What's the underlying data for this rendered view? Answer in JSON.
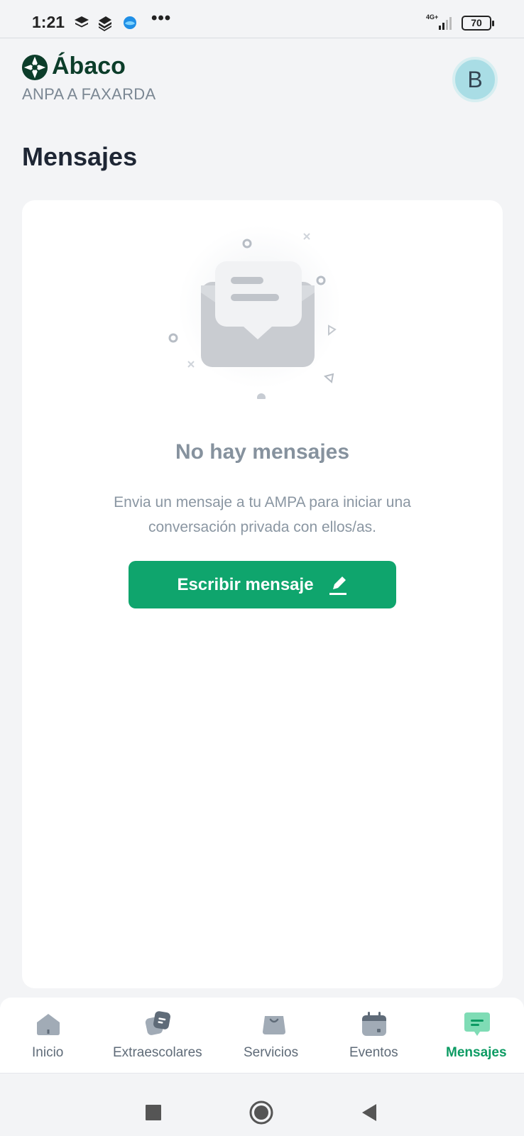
{
  "status_bar": {
    "time": "1:21",
    "overflow": "•••",
    "network": "4G+",
    "battery": "70",
    "notification_icons": [
      "layers-icon",
      "stack-icon",
      "browser-icon"
    ]
  },
  "header": {
    "brand_name": "Ábaco",
    "organization": "ANPA A FAXARDA",
    "avatar_initial": "B"
  },
  "page": {
    "title": "Mensajes"
  },
  "empty_state": {
    "title": "No hay mensajes",
    "description": "Envia un mensaje a tu AMPA para iniciar una conversación privada con ellos/as.",
    "button_label": "Escribir mensaje",
    "button_icon": "pencil-icon"
  },
  "bottom_nav": {
    "items": [
      {
        "label": "Inicio",
        "icon": "home-icon",
        "active": false
      },
      {
        "label": "Extraescolares",
        "icon": "extracurricular-icon",
        "active": false
      },
      {
        "label": "Servicios",
        "icon": "shopping-bag-icon",
        "active": false
      },
      {
        "label": "Eventos",
        "icon": "calendar-icon",
        "active": false
      },
      {
        "label": "Mensajes",
        "icon": "chat-icon",
        "active": true
      }
    ]
  },
  "colors": {
    "accent": "#0fa56d",
    "brand": "#0c3d2a",
    "background": "#f3f4f6"
  }
}
